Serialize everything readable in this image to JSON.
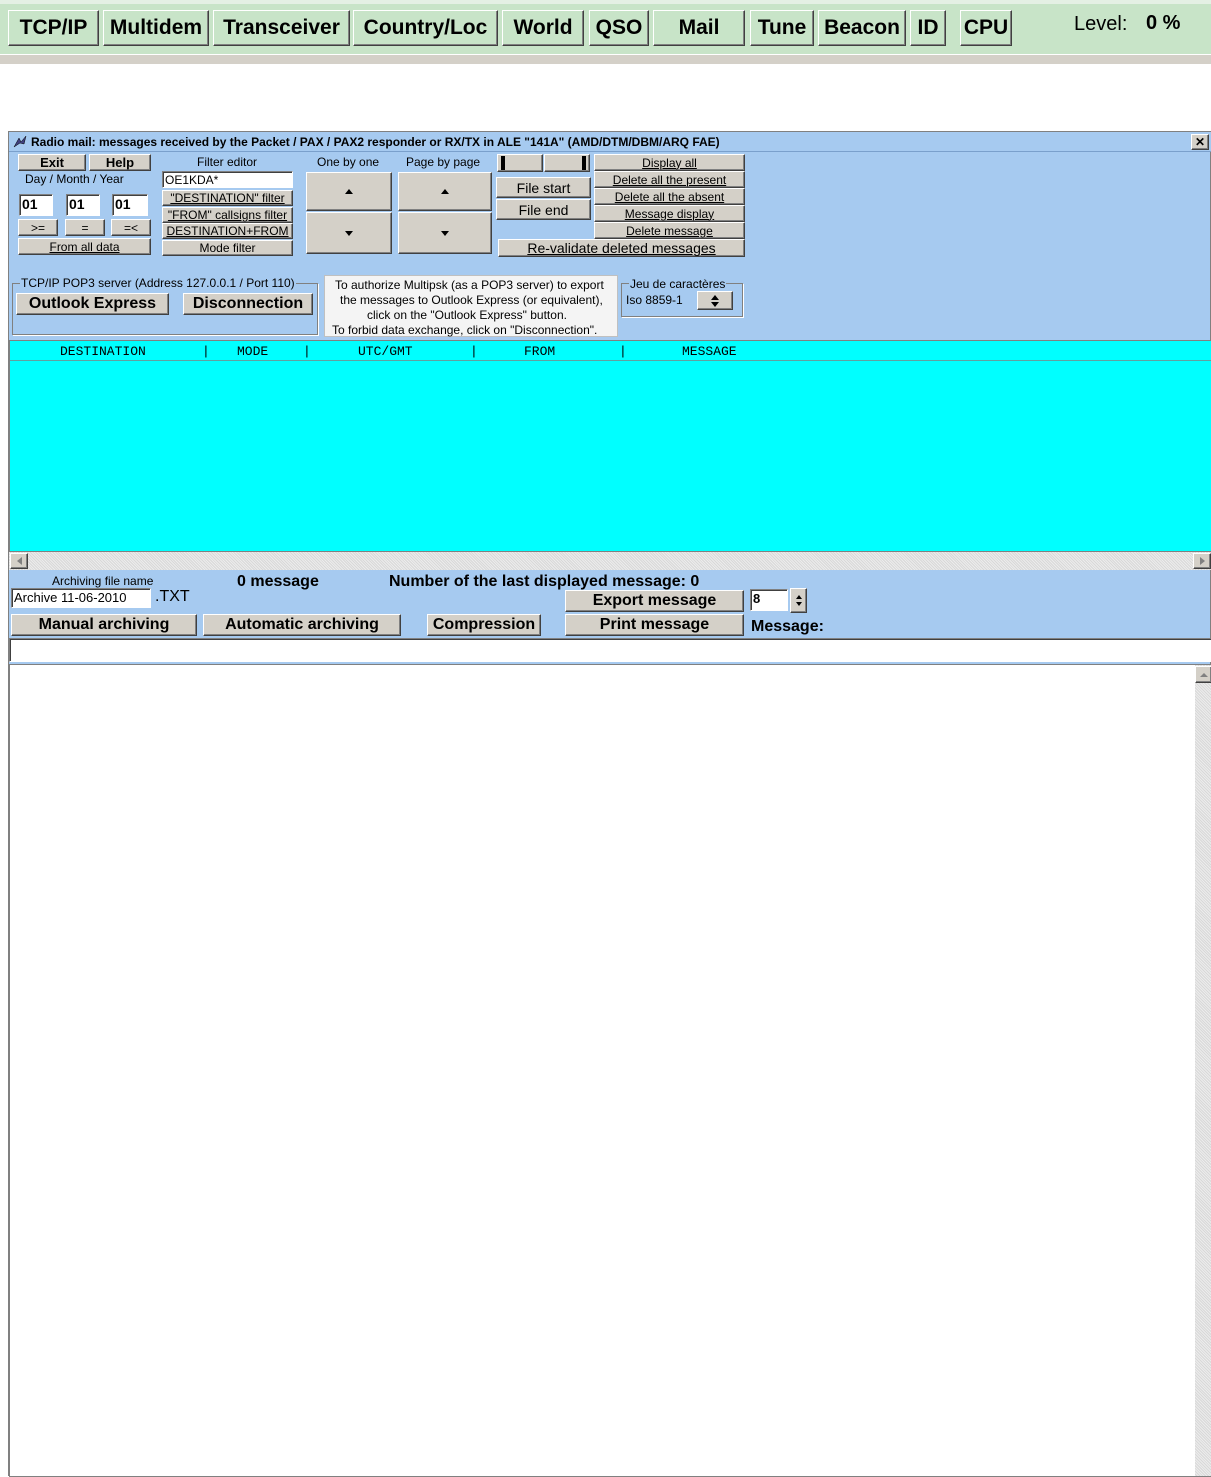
{
  "toolbar": {
    "buttons": [
      "TCP/IP",
      "Multidem",
      "Transceiver",
      "Country/Loc",
      "World",
      "QSO",
      "Mail",
      "Tune",
      "Beacon",
      "ID",
      "CPU"
    ],
    "level_label": "Level:",
    "level_value": "0 %"
  },
  "window": {
    "title": "Radio mail: messages received by the Packet / PAX / PAX2 responder or RX/TX in ALE \"141A\" (AMD/DTM/DBM/ARQ FAE)",
    "close_glyph": "✕"
  },
  "controls": {
    "exit": "Exit",
    "help": "Help",
    "date_label": "Day  /  Month / Year",
    "day": "01",
    "month": "01",
    "year": "01",
    "gte": ">=",
    "eq": "=",
    "lte": "=<",
    "from_all_data": "From all data",
    "filter_editor": "Filter editor",
    "filter_value": "OE1KDA*",
    "destination_filter": "\"DESTINATION\" filter",
    "from_filter": "\"FROM\" callsigns filter",
    "dest_from": "DESTINATION+FROM",
    "mode_filter": "Mode filter",
    "one_by_one": "One by one",
    "page_by_page": "Page by page",
    "file_start": "File start",
    "file_end": "File end",
    "display_all": "Display all",
    "delete_present": "Delete all the present",
    "delete_absent": "Delete all the absent",
    "message_display": "Message display",
    "delete_message": "Delete message",
    "revalidate": "Re-validate deleted messages"
  },
  "pop3": {
    "group_label": "TCP/IP POP3 server (Address 127.0.0.1 / Port 110)",
    "outlook": "Outlook Express",
    "disconnection": "Disconnection",
    "info_line1": "To authorize Multipsk (as a POP3 server) to export",
    "info_line2": "the messages to Outlook Express (or equivalent),",
    "info_line3": "click on the \"Outlook Express\" button.",
    "info_line4": "To forbid data exchange, click on \"Disconnection\".",
    "charset_label": "Jeu de caractères",
    "charset_value": "Iso 8859-1"
  },
  "table": {
    "headers": [
      "DESTINATION",
      "MODE",
      "UTC/GMT",
      "FROM",
      "MESSAGE"
    ]
  },
  "archive": {
    "file_name_label": "Archiving file name",
    "file_name_value": "Archive 11-06-2010",
    "extension": ".TXT",
    "message_count": "0 message",
    "last_displayed": "Number of the last displayed message: 0",
    "export_message": "Export message",
    "spinner_value": "8",
    "manual_archiving": "Manual archiving",
    "automatic_archiving": "Automatic archiving",
    "compression": "Compression",
    "print_message": "Print message",
    "message_label": "Message:"
  },
  "colors": {
    "window_blue": "#a6caf0",
    "list_cyan": "#00ffff",
    "toolbar_green": "#c8e4c8",
    "title_bar": "#3a6ea5"
  }
}
